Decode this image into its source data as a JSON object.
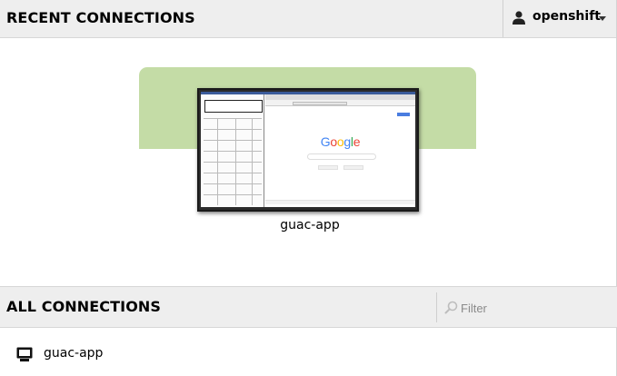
{
  "recent": {
    "title": "RECENT CONNECTIONS",
    "connections": [
      {
        "name": "guac-app",
        "thumbnail_text": "Google"
      }
    ]
  },
  "user_menu": {
    "username": "openshift",
    "icon": "user-icon"
  },
  "all": {
    "title": "ALL CONNECTIONS",
    "filter": {
      "placeholder": "Filter",
      "value": "",
      "icon": "search-icon"
    },
    "connections": [
      {
        "name": "guac-app",
        "icon": "monitor-icon"
      }
    ]
  },
  "colors": {
    "header_bg": "#eeeeee",
    "recent_card_bg": "#c4dca6",
    "border": "#d7d7d7"
  }
}
